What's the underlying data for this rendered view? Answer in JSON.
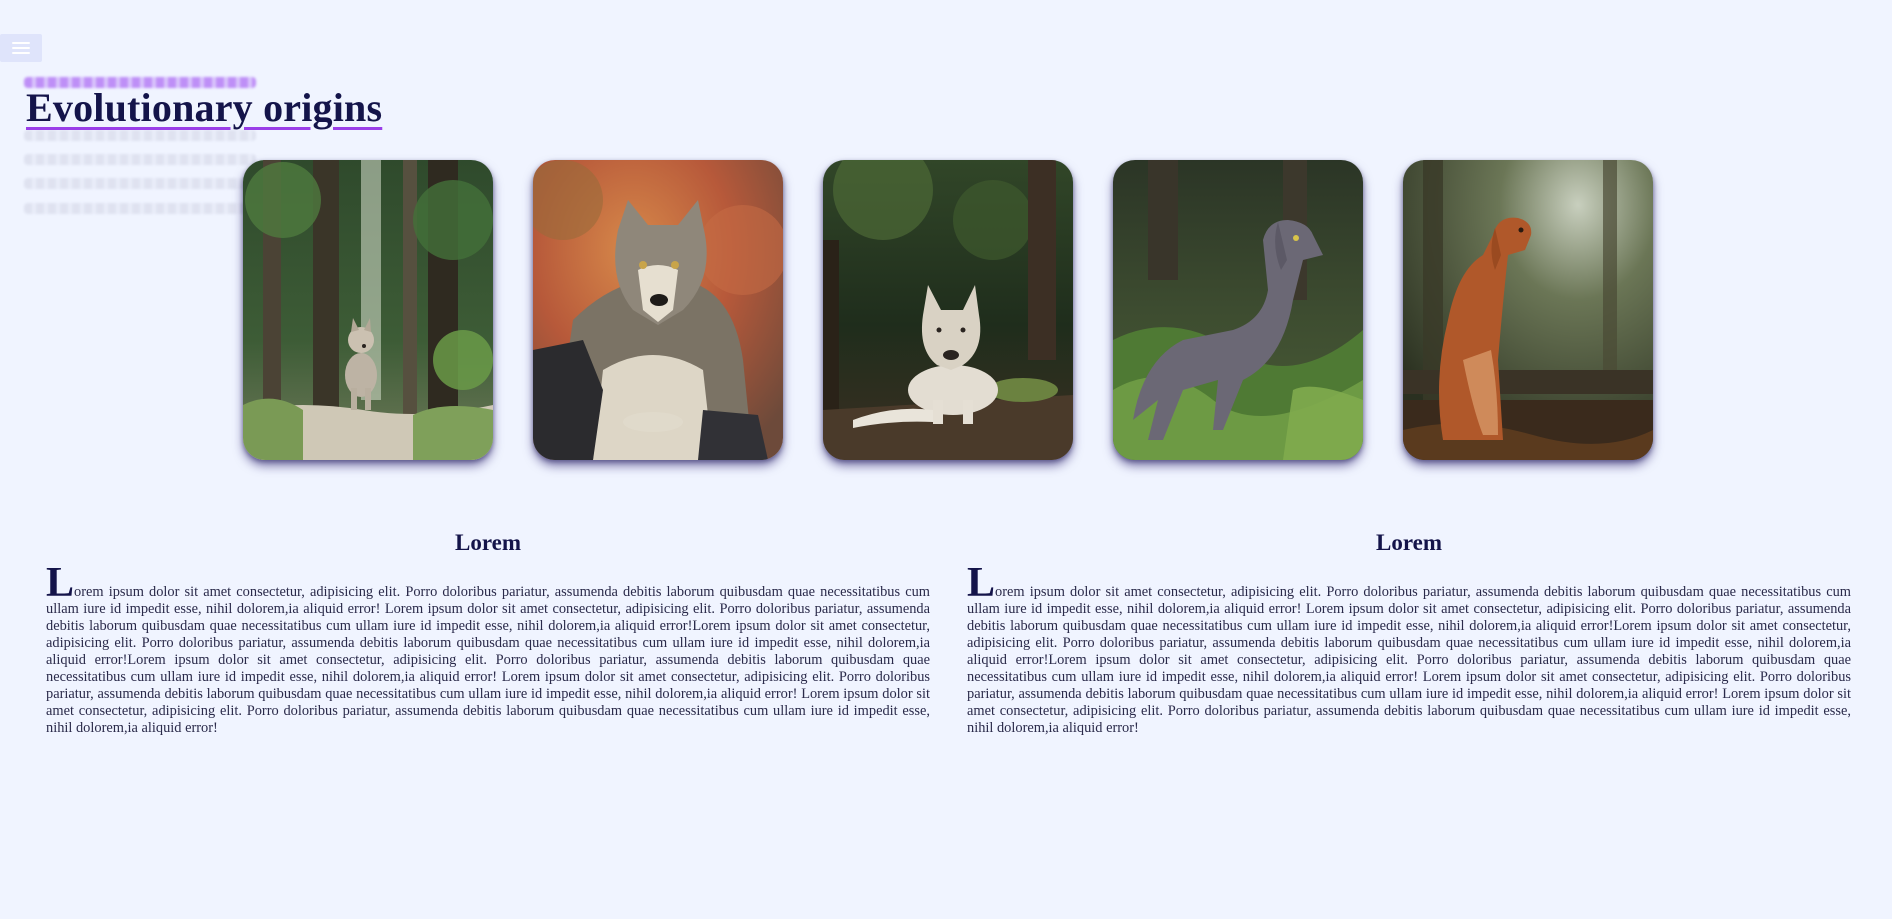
{
  "header": {
    "title": "Evolutionary origins",
    "menu_icon": "hamburger-menu-icon"
  },
  "gallery": {
    "images": [
      {
        "subject": "wolf pup in forest"
      },
      {
        "subject": "grey wolf lying on rocks"
      },
      {
        "subject": "white husky lying in forest"
      },
      {
        "subject": "grey weimaraner dog in grass"
      },
      {
        "subject": "red retriever sitting in forest"
      }
    ]
  },
  "articles": [
    {
      "heading": "Lorem",
      "dropcap": "L",
      "body": "orem ipsum dolor sit amet consectetur, adipisicing elit. Porro doloribus pariatur, assumenda debitis laborum quibusdam quae necessitatibus cum ullam iure id impedit esse, nihil dolorem,ia aliquid error! Lorem ipsum dolor sit amet consectetur, adipisicing elit. Porro doloribus pariatur, assumenda debitis laborum quibusdam quae necessitatibus cum ullam iure id impedit esse, nihil dolorem,ia aliquid error!Lorem ipsum dolor sit amet consectetur, adipisicing elit. Porro doloribus pariatur, assumenda debitis laborum quibusdam quae necessitatibus cum ullam iure id impedit esse, nihil dolorem,ia aliquid error!Lorem ipsum dolor sit amet consectetur, adipisicing elit. Porro doloribus pariatur, assumenda debitis laborum quibusdam quae necessitatibus cum ullam iure id impedit esse, nihil dolorem,ia aliquid error! Lorem ipsum dolor sit amet consectetur, adipisicing elit. Porro doloribus pariatur, assumenda debitis laborum quibusdam quae necessitatibus cum ullam iure id impedit esse, nihil dolorem,ia aliquid error! Lorem ipsum dolor sit amet consectetur, adipisicing elit. Porro doloribus pariatur, assumenda debitis laborum quibusdam quae necessitatibus cum ullam iure id impedit esse, nihil dolorem,ia aliquid error!"
    },
    {
      "heading": "Lorem",
      "dropcap": "L",
      "body": "orem ipsum dolor sit amet consectetur, adipisicing elit. Porro doloribus pariatur, assumenda debitis laborum quibusdam quae necessitatibus cum ullam iure id impedit esse, nihil dolorem,ia aliquid error! Lorem ipsum dolor sit amet consectetur, adipisicing elit. Porro doloribus pariatur, assumenda debitis laborum quibusdam quae necessitatibus cum ullam iure id impedit esse, nihil dolorem,ia aliquid error!Lorem ipsum dolor sit amet consectetur, adipisicing elit. Porro doloribus pariatur, assumenda debitis laborum quibusdam quae necessitatibus cum ullam iure id impedit esse, nihil dolorem,ia aliquid error!Lorem ipsum dolor sit amet consectetur, adipisicing elit. Porro doloribus pariatur, assumenda debitis laborum quibusdam quae necessitatibus cum ullam iure id impedit esse, nihil dolorem,ia aliquid error! Lorem ipsum dolor sit amet consectetur, adipisicing elit. Porro doloribus pariatur, assumenda debitis laborum quibusdam quae necessitatibus cum ullam iure id impedit esse, nihil dolorem,ia aliquid error! Lorem ipsum dolor sit amet consectetur, adipisicing elit. Porro doloribus pariatur, assumenda debitis laborum quibusdam quae necessitatibus cum ullam iure id impedit esse, nihil dolorem,ia aliquid error!"
    }
  ],
  "colors": {
    "background": "#f0f4ff",
    "text": "#14144a",
    "accent": "#9a3ee8"
  }
}
